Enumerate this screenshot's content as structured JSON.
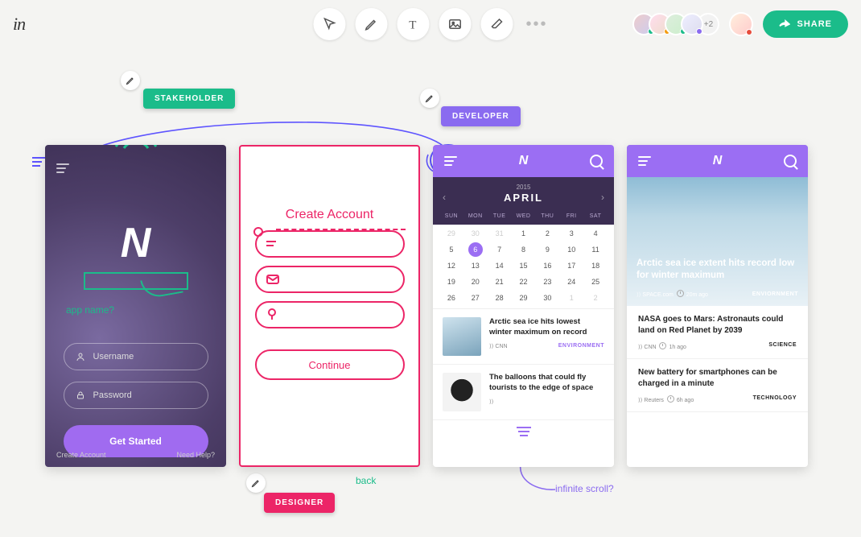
{
  "app": {
    "logo": "in"
  },
  "toolbar": {
    "tools": [
      "pointer",
      "pencil",
      "text",
      "image",
      "eraser"
    ],
    "more": "•••",
    "share_label": "SHARE",
    "collaborator_overflow": "+2"
  },
  "collaborators": [
    {
      "status_color": "#1bbc8a"
    },
    {
      "status_color": "#f39c12"
    },
    {
      "status_color": "#1bbc8a"
    },
    {
      "status_color": "#8a6bf0"
    }
  ],
  "me": {
    "status_color": "#e74c3c"
  },
  "labels": {
    "stakeholder": "STAKEHOLDER",
    "developer": "DEVELOPER",
    "designer": "DESIGNER"
  },
  "annotations": {
    "app_name_q": "app name?",
    "back": "back",
    "infinite_scroll": "infinite scroll?"
  },
  "frame1": {
    "username_label": "Username",
    "password_label": "Password",
    "cta": "Get Started",
    "create_account": "Create Account",
    "need_help": "Need Help?"
  },
  "frame2": {
    "title": "Create Account",
    "cta": "Continue"
  },
  "frame3": {
    "year": "2015",
    "month": "APRIL",
    "day_names": [
      "SUN",
      "MON",
      "TUE",
      "WED",
      "THU",
      "FRI",
      "SAT"
    ],
    "grid": [
      {
        "d": "29",
        "muted": true
      },
      {
        "d": "30",
        "muted": true
      },
      {
        "d": "31",
        "muted": true
      },
      {
        "d": "1"
      },
      {
        "d": "2"
      },
      {
        "d": "3"
      },
      {
        "d": "4"
      },
      {
        "d": "5"
      },
      {
        "d": "6",
        "today": true
      },
      {
        "d": "7"
      },
      {
        "d": "8"
      },
      {
        "d": "9"
      },
      {
        "d": "10"
      },
      {
        "d": "11"
      },
      {
        "d": "12"
      },
      {
        "d": "13"
      },
      {
        "d": "14"
      },
      {
        "d": "15"
      },
      {
        "d": "16"
      },
      {
        "d": "17"
      },
      {
        "d": "18"
      },
      {
        "d": "19"
      },
      {
        "d": "20"
      },
      {
        "d": "21"
      },
      {
        "d": "22"
      },
      {
        "d": "23"
      },
      {
        "d": "24"
      },
      {
        "d": "25"
      },
      {
        "d": "26"
      },
      {
        "d": "27"
      },
      {
        "d": "28"
      },
      {
        "d": "29"
      },
      {
        "d": "30"
      },
      {
        "d": "1",
        "muted": true
      },
      {
        "d": "2",
        "muted": true
      }
    ],
    "items": [
      {
        "title": "Arctic sea ice hits lowest winter maximum on record",
        "source": "CNN",
        "tag": "ENVIRONMENT"
      },
      {
        "title": "The balloons that could fly tourists to the edge of space",
        "source": "",
        "tag": ""
      }
    ]
  },
  "frame4": {
    "hero": {
      "title": "Arctic sea ice extent hits record low for winter maximum",
      "source": "SPACE.com",
      "time": "20m ago",
      "tag": "ENVIORNMENT"
    },
    "items": [
      {
        "title": "NASA goes to Mars: Astronauts could land on Red Planet by 2039",
        "source": "CNN",
        "time": "1h ago",
        "tag": "SCIENCE"
      },
      {
        "title": "New battery for smartphones can be charged in a minute",
        "source": "Reuters",
        "time": "6h ago",
        "tag": "TECHNOLOGY"
      }
    ]
  },
  "colors": {
    "green": "#1bbc8a",
    "purple": "#9b6ef3",
    "magenta": "#ec2567",
    "violet_ink": "#5e54ff"
  }
}
